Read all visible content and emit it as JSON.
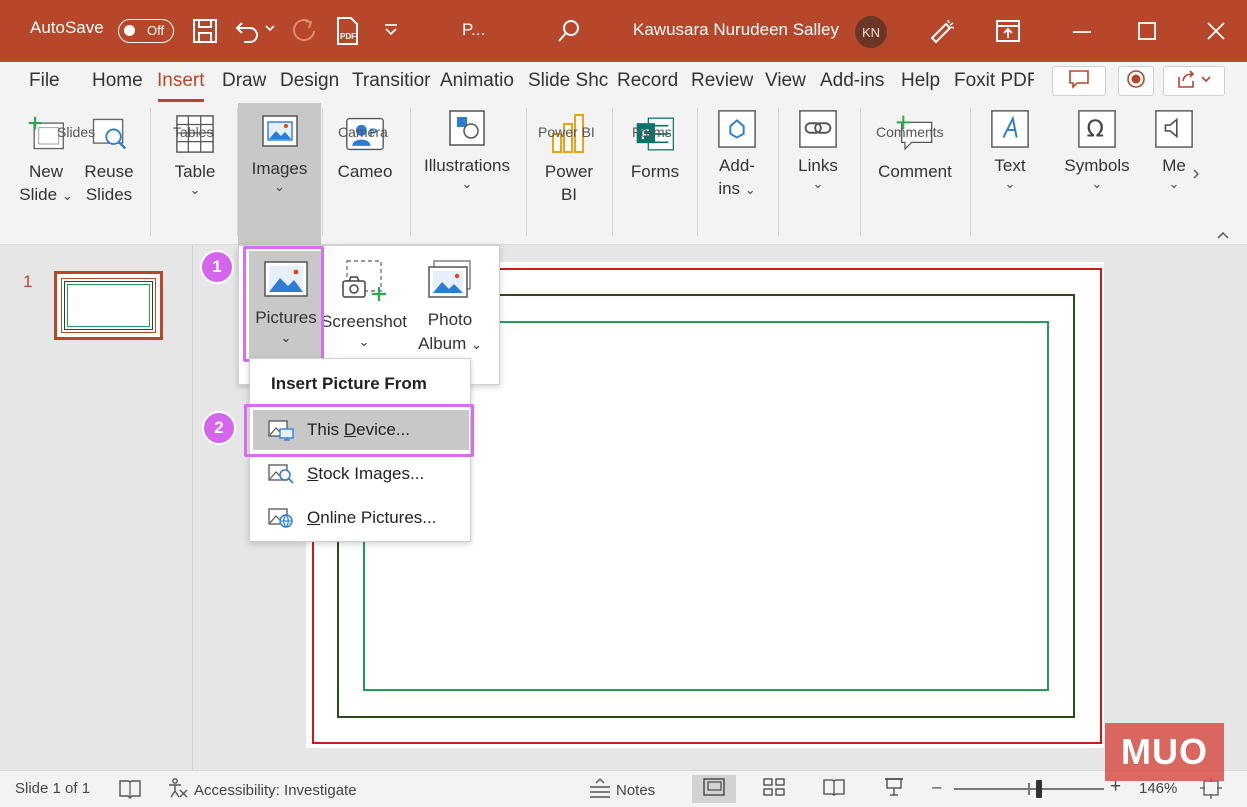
{
  "titlebar": {
    "autosave_label": "AutoSave",
    "autosave_state": "Off",
    "doc_title": "P...",
    "user_name": "Kawusara Nurudeen Salley",
    "avatar_initials": "KN",
    "bg_color": "#b7472a"
  },
  "tabs": {
    "items": [
      "File",
      "Home",
      "Insert",
      "Draw",
      "Design",
      "Transitior",
      "Animatio",
      "Slide Shc",
      "Record",
      "Review",
      "View",
      "Add-ins",
      "Help",
      "Foxit PDF"
    ],
    "active": "Insert"
  },
  "ribbon": {
    "new_slide": [
      "New",
      "Slide"
    ],
    "reuse_slides": [
      "Reuse",
      "Slides"
    ],
    "table": "Table",
    "images": "Images",
    "cameo": "Cameo",
    "illustrations": "Illustrations",
    "power_bi": [
      "Power",
      "BI"
    ],
    "forms": "Forms",
    "add_ins": [
      "Add-",
      "ins"
    ],
    "links": "Links",
    "comment": "Comment",
    "text": "Text",
    "symbols": "Symbols",
    "media": "Me",
    "groups": {
      "slides": "Slides",
      "tables": "Tables",
      "camera": "Camera",
      "power_bi": "Power BI",
      "forms": "Forms",
      "comments": "Comments"
    }
  },
  "images_dropdown": {
    "pictures": "Pictures",
    "screenshot": "Screenshot",
    "photo_album": [
      "Photo",
      "Album"
    ]
  },
  "picture_menu": {
    "header": "Insert Picture From",
    "this_device": {
      "accel": "D",
      "pre": "This ",
      "post": "evice..."
    },
    "stock_images": {
      "accel": "S",
      "post": "tock Images..."
    },
    "online_pictures": {
      "accel": "O",
      "post": "nline Pictures..."
    }
  },
  "steps": [
    "1",
    "2"
  ],
  "thumbnails": {
    "slide_number": "1"
  },
  "statusbar": {
    "slide_info": "Slide 1 of 1",
    "accessibility": "Accessibility: Investigate",
    "notes": "Notes",
    "zoom_minus": "–",
    "zoom_plus": "+",
    "zoom": "146%"
  },
  "watermark": "MUO",
  "colors": {
    "accent": "#b7472a",
    "highlight": "#d86df0",
    "frame_red": "#d11919",
    "frame_dark_green": "#2d4a1e",
    "frame_green": "#1f9e5a"
  }
}
